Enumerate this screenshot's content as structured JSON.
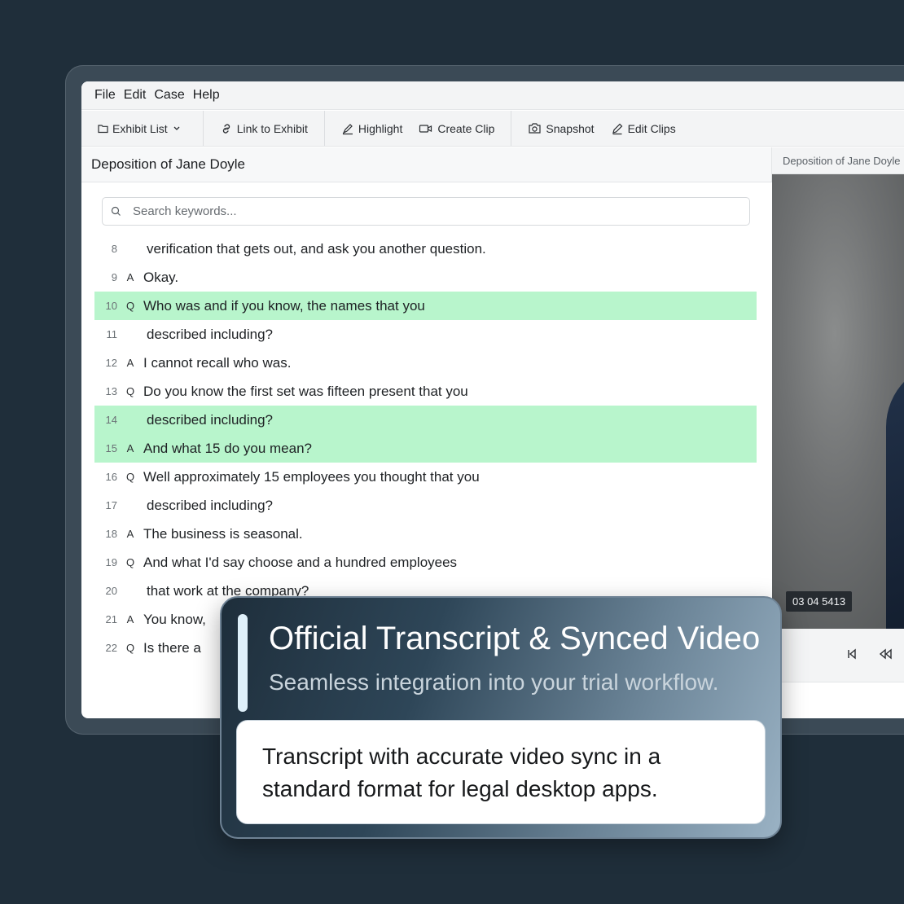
{
  "menu": [
    "File",
    "Edit",
    "Case",
    "Help"
  ],
  "toolbar": {
    "exhibit_list": "Exhibit List",
    "link_to_exhibit": "Link to Exhibit",
    "highlight": "Highlight",
    "create_clip": "Create Clip",
    "snapshot": "Snapshot",
    "edit_clips": "Edit Clips"
  },
  "document": {
    "title": "Deposition of Jane Doyle",
    "search_placeholder": "Search keywords..."
  },
  "transcript": [
    {
      "num": "8",
      "speaker": "",
      "text": "verification that gets out, and ask you another question.",
      "highlight": false
    },
    {
      "num": "9",
      "speaker": "A",
      "text": "Okay.",
      "highlight": false
    },
    {
      "num": "10",
      "speaker": "Q",
      "text": "Who was and if you know, the names that you",
      "highlight": true
    },
    {
      "num": "11",
      "speaker": "",
      "text": "described including?",
      "highlight": false
    },
    {
      "num": "12",
      "speaker": "A",
      "text": "I cannot recall who was.",
      "highlight": false
    },
    {
      "num": "13",
      "speaker": "Q",
      "text": "Do you know the first set was fifteen present that you",
      "highlight": false
    },
    {
      "num": "14",
      "speaker": "",
      "text": "described including?",
      "highlight": true
    },
    {
      "num": "15",
      "speaker": "A",
      "text": "And what 15 do you mean?",
      "highlight": true
    },
    {
      "num": "16",
      "speaker": "Q",
      "text": "Well approximately 15 employees you thought that you",
      "highlight": false
    },
    {
      "num": "17",
      "speaker": "",
      "text": "described including?",
      "highlight": false
    },
    {
      "num": "18",
      "speaker": "A",
      "text": "The business is seasonal.",
      "highlight": false
    },
    {
      "num": "19",
      "speaker": "Q",
      "text": "And what I'd say choose and a hundred employees",
      "highlight": false
    },
    {
      "num": "20",
      "speaker": "",
      "text": "that work at the company?",
      "highlight": false
    },
    {
      "num": "21",
      "speaker": "A",
      "text": "You know,",
      "highlight": false
    },
    {
      "num": "22",
      "speaker": "Q",
      "text": "Is there a",
      "highlight": false
    }
  ],
  "video": {
    "title": "Deposition of Jane Doyle",
    "timecode": "03 04 5413"
  },
  "overlay": {
    "title": "Official Transcript & Synced Video",
    "subtitle": "Seamless integration into your trial workflow.",
    "body": "Transcript with accurate video sync in a standard format for legal desktop apps."
  },
  "colors": {
    "background": "#1f2e3a",
    "highlight": "#b8f5cc",
    "accent_bar": "#dff0fa"
  }
}
